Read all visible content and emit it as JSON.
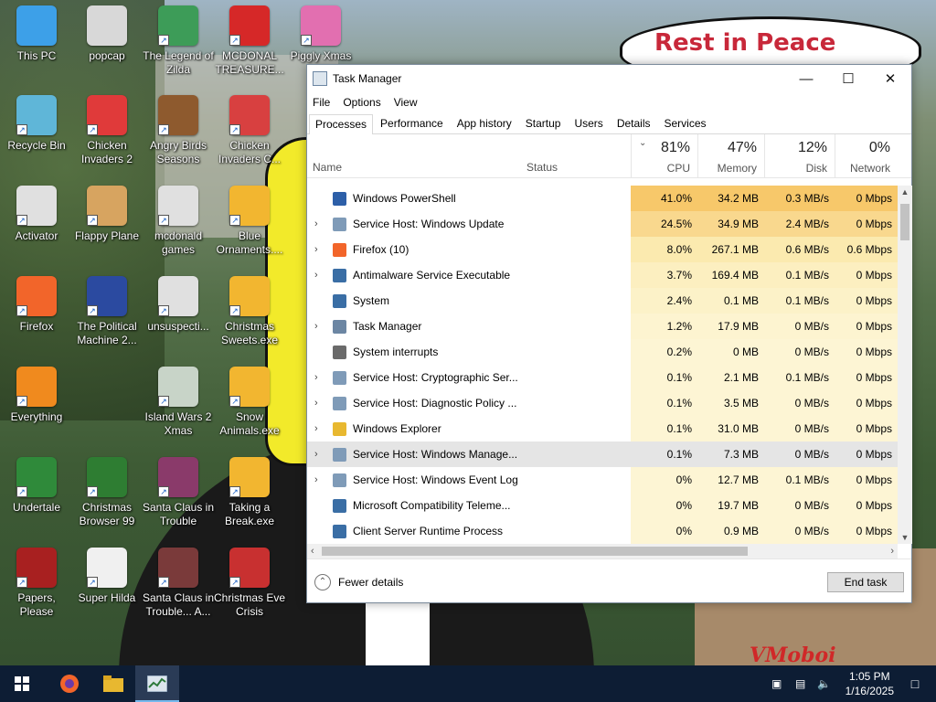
{
  "desktop": {
    "wallpaper_text": "Rest in Peace",
    "wallpaper_signature": "VMoboi",
    "icons": [
      {
        "label": "This PC",
        "color": "#3da0e8"
      },
      {
        "label": "popcap",
        "color": "#d8d8d8"
      },
      {
        "label": "The Legend of Zilda",
        "color": "#3d9c58"
      },
      {
        "label": "MCDONAL TREASURE...",
        "color": "#d62828"
      },
      {
        "label": "Piggly Xmas",
        "color": "#e26fb0"
      },
      {
        "label": "Recycle Bin",
        "color": "#5fb6d8"
      },
      {
        "label": "Chicken Invaders 2",
        "color": "#e03a3a"
      },
      {
        "label": "Angry Birds Seasons",
        "color": "#8e5a2e"
      },
      {
        "label": "Chicken Invaders C...",
        "color": "#d84040"
      },
      {
        "label": "Activator",
        "color": "#e0e0e0"
      },
      {
        "label": "Flappy Plane",
        "color": "#d7a460"
      },
      {
        "label": "mcdonald games",
        "color": "#e0e0e0"
      },
      {
        "label": "Blue Ornaments....",
        "color": "#f2b630"
      },
      {
        "label": "Firefox",
        "color": "#f2652a"
      },
      {
        "label": "The Political Machine 2...",
        "color": "#2b4aa0"
      },
      {
        "label": "unsuspecti...",
        "color": "#e0e0e0"
      },
      {
        "label": "Christmas Sweets.exe",
        "color": "#f2b630"
      },
      {
        "label": "Everything",
        "color": "#f08a1e"
      },
      {
        "label": "Island Wars 2 Xmas",
        "color": "#c8d4c8"
      },
      {
        "label": "Snow Animals.exe",
        "color": "#f2b630"
      },
      {
        "label": "Undertale",
        "color": "#2f8a3a"
      },
      {
        "label": "Christmas Browser 99",
        "color": "#2e7d32"
      },
      {
        "label": "Santa Claus in Trouble",
        "color": "#8a3a6a"
      },
      {
        "label": "Taking a Break.exe",
        "color": "#f2b630"
      },
      {
        "label": "Papers, Please",
        "color": "#a82020"
      },
      {
        "label": "Super Hilda",
        "color": "#f0f0f0"
      },
      {
        "label": "Santa Claus in Trouble... A...",
        "color": "#7a3a3a"
      },
      {
        "label": "Christmas Eve Crisis",
        "color": "#c83030"
      }
    ]
  },
  "task_manager": {
    "title": "Task Manager",
    "menu": [
      "File",
      "Options",
      "View"
    ],
    "tabs": [
      "Processes",
      "Performance",
      "App history",
      "Startup",
      "Users",
      "Details",
      "Services"
    ],
    "active_tab": "Processes",
    "columns": {
      "name": "Name",
      "status": "Status",
      "cpu": {
        "pct": "81%",
        "label": "CPU"
      },
      "memory": {
        "pct": "47%",
        "label": "Memory"
      },
      "disk": {
        "pct": "12%",
        "label": "Disk"
      },
      "network": {
        "pct": "0%",
        "label": "Network"
      }
    },
    "processes": [
      {
        "name": "Windows PowerShell",
        "expandable": false,
        "cpu": "41.0%",
        "memory": "34.2 MB",
        "disk": "0.3 MB/s",
        "network": "0 Mbps",
        "icon_color": "#2d5fa8",
        "heat": "#f7c86a"
      },
      {
        "name": "Service Host: Windows Update",
        "expandable": true,
        "cpu": "24.5%",
        "memory": "34.9 MB",
        "disk": "2.4 MB/s",
        "network": "0 Mbps",
        "icon_color": "#7f9bb8",
        "heat": "#f9d88e"
      },
      {
        "name": "Firefox (10)",
        "expandable": true,
        "cpu": "8.0%",
        "memory": "267.1 MB",
        "disk": "0.6 MB/s",
        "network": "0.6 Mbps",
        "icon_color": "#f2652a",
        "heat": "#fbeaaf"
      },
      {
        "name": "Antimalware Service Executable",
        "expandable": true,
        "cpu": "3.7%",
        "memory": "169.4 MB",
        "disk": "0.1 MB/s",
        "network": "0 Mbps",
        "icon_color": "#3a6ea5",
        "heat": "#fcefc0"
      },
      {
        "name": "System",
        "expandable": false,
        "cpu": "2.4%",
        "memory": "0.1 MB",
        "disk": "0.1 MB/s",
        "network": "0 Mbps",
        "icon_color": "#3a6ea5",
        "heat": "#fcf2c8"
      },
      {
        "name": "Task Manager",
        "expandable": true,
        "cpu": "1.2%",
        "memory": "17.9 MB",
        "disk": "0 MB/s",
        "network": "0 Mbps",
        "icon_color": "#6c86a3",
        "heat": "#fdf4d0"
      },
      {
        "name": "System interrupts",
        "expandable": false,
        "cpu": "0.2%",
        "memory": "0 MB",
        "disk": "0 MB/s",
        "network": "0 Mbps",
        "icon_color": "#6a6a6a",
        "heat": "#fdf5d4"
      },
      {
        "name": "Service Host: Cryptographic Ser...",
        "expandable": true,
        "cpu": "0.1%",
        "memory": "2.1 MB",
        "disk": "0.1 MB/s",
        "network": "0 Mbps",
        "icon_color": "#7f9bb8",
        "heat": "#fdf5d4"
      },
      {
        "name": "Service Host: Diagnostic Policy ...",
        "expandable": true,
        "cpu": "0.1%",
        "memory": "3.5 MB",
        "disk": "0 MB/s",
        "network": "0 Mbps",
        "icon_color": "#7f9bb8",
        "heat": "#fdf5d4"
      },
      {
        "name": "Windows Explorer",
        "expandable": true,
        "cpu": "0.1%",
        "memory": "31.0 MB",
        "disk": "0 MB/s",
        "network": "0 Mbps",
        "icon_color": "#e8b830",
        "heat": "#fdf5d4"
      },
      {
        "name": "Service Host: Windows Manage...",
        "expandable": true,
        "cpu": "0.1%",
        "memory": "7.3 MB",
        "disk": "0 MB/s",
        "network": "0 Mbps",
        "icon_color": "#7f9bb8",
        "heat": "#fdf5d4",
        "selected": true
      },
      {
        "name": "Service Host: Windows Event Log",
        "expandable": true,
        "cpu": "0%",
        "memory": "12.7 MB",
        "disk": "0.1 MB/s",
        "network": "0 Mbps",
        "icon_color": "#7f9bb8",
        "heat": "#fdf5d4"
      },
      {
        "name": "Microsoft Compatibility Teleme...",
        "expandable": false,
        "cpu": "0%",
        "memory": "19.7 MB",
        "disk": "0 MB/s",
        "network": "0 Mbps",
        "icon_color": "#3a6ea5",
        "heat": "#fdf5d4"
      },
      {
        "name": "Client Server Runtime Process",
        "expandable": false,
        "cpu": "0%",
        "memory": "0.9 MB",
        "disk": "0 MB/s",
        "network": "0 Mbps",
        "icon_color": "#3a6ea5",
        "heat": "#fdf5d4"
      }
    ],
    "fewer_details": "Fewer details",
    "end_task": "End task"
  },
  "taskbar": {
    "time": "1:05 PM",
    "date": "1/16/2025"
  }
}
